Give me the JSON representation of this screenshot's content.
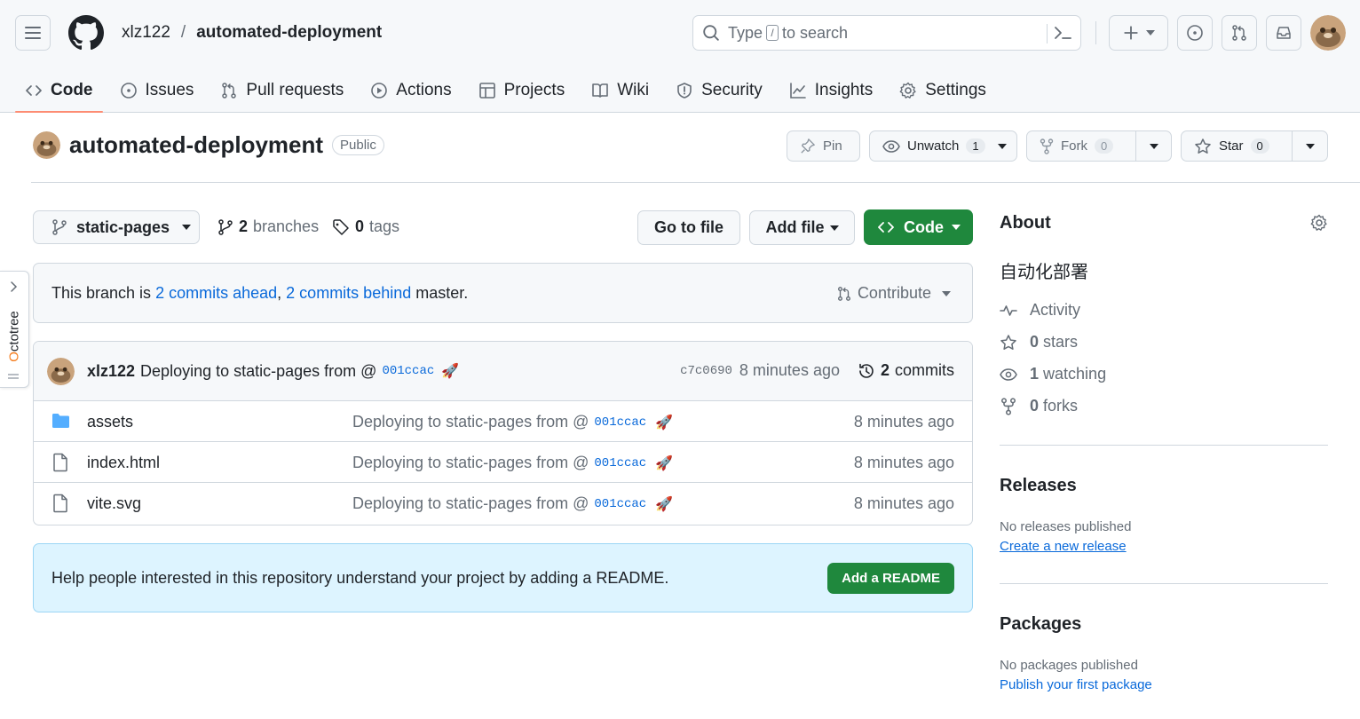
{
  "header": {
    "owner": "xlz122",
    "separator": "/",
    "repo": "automated-deployment",
    "search": {
      "before": "Type",
      "key": "/",
      "after": "to search"
    }
  },
  "tabs": [
    {
      "label": "Code",
      "icon": "code-icon",
      "selected": true
    },
    {
      "label": "Issues",
      "icon": "issue-icon"
    },
    {
      "label": "Pull requests",
      "icon": "pull-request-icon"
    },
    {
      "label": "Actions",
      "icon": "play-icon"
    },
    {
      "label": "Projects",
      "icon": "table-icon"
    },
    {
      "label": "Wiki",
      "icon": "book-icon"
    },
    {
      "label": "Security",
      "icon": "shield-icon"
    },
    {
      "label": "Insights",
      "icon": "graph-icon"
    },
    {
      "label": "Settings",
      "icon": "gear-icon"
    }
  ],
  "repo_head": {
    "name": "automated-deployment",
    "visibility": "Public",
    "pin": "Pin",
    "unwatch": "Unwatch",
    "watch_count": "1",
    "fork": "Fork",
    "fork_count": "0",
    "star": "Star",
    "star_count": "0"
  },
  "file_nav": {
    "branch": "static-pages",
    "branches_count": "2",
    "branches_label": "branches",
    "tags_count": "0",
    "tags_label": "tags",
    "go_to_file": "Go to file",
    "add_file": "Add file",
    "code": "Code"
  },
  "branch_info": {
    "prefix": "This branch is",
    "ahead": "2 commits ahead",
    "comma": ",",
    "behind": "2 commits behind",
    "suffix": "master.",
    "contribute": "Contribute"
  },
  "latest_commit": {
    "author": "xlz122",
    "message": "Deploying to static-pages from @",
    "sha_link": "001ccac",
    "emoji": "🚀",
    "hash": "c7c0690",
    "age": "8 minutes ago",
    "commits_count": "2",
    "commits_label": "commits"
  },
  "files": [
    {
      "name": "assets",
      "type": "dir",
      "message": "Deploying to static-pages from @",
      "sha": "001ccac",
      "emoji": "🚀",
      "age": "8 minutes ago"
    },
    {
      "name": "index.html",
      "type": "file",
      "message": "Deploying to static-pages from @",
      "sha": "001ccac",
      "emoji": "🚀",
      "age": "8 minutes ago"
    },
    {
      "name": "vite.svg",
      "type": "file",
      "message": "Deploying to static-pages from @",
      "sha": "001ccac",
      "emoji": "🚀",
      "age": "8 minutes ago"
    }
  ],
  "readme_banner": {
    "text": "Help people interested in this repository understand your project by adding a README.",
    "button": "Add a README"
  },
  "sidebar": {
    "about_title": "About",
    "description": "自动化部署",
    "activity": "Activity",
    "stars_count": "0",
    "stars_label": "stars",
    "watching_count": "1",
    "watching_label": "watching",
    "forks_count": "0",
    "forks_label": "forks",
    "releases_title": "Releases",
    "releases_none": "No releases published",
    "releases_link": "Create a new release",
    "packages_title": "Packages",
    "packages_none": "No packages published",
    "packages_link": "Publish your first package"
  },
  "octotree": {
    "label_o": "O",
    "label_rest": "ctotree"
  },
  "colors": {
    "accent_green": "#1f883d",
    "link_blue": "#0969da",
    "tab_underline": "#fd8c73",
    "folder_blue": "#54aeff",
    "banner_bg": "#ddf4ff"
  }
}
